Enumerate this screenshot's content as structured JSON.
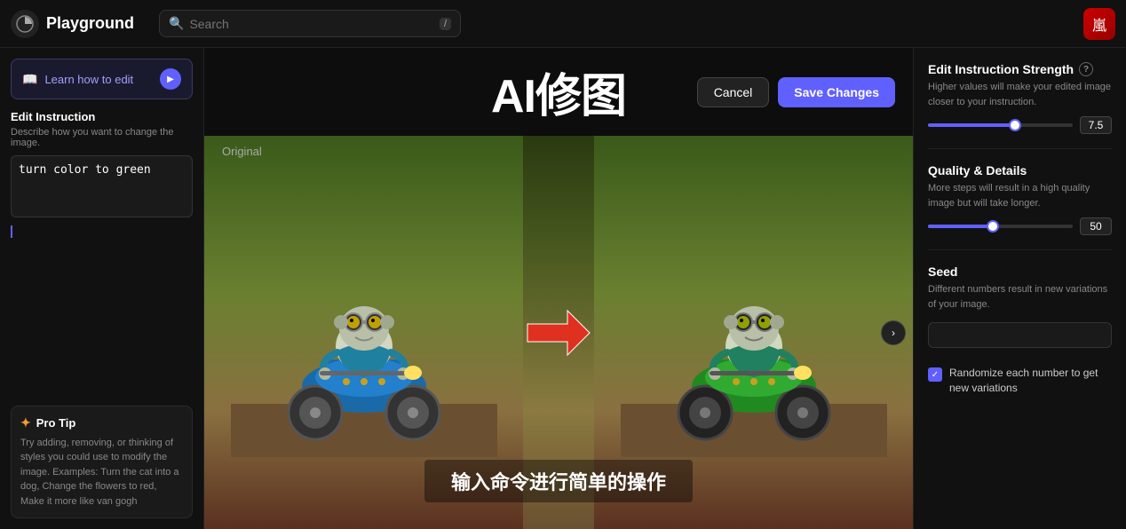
{
  "topbar": {
    "logo_icon": "◑",
    "logo_text": "Playground",
    "search_placeholder": "Search",
    "kbd": "/",
    "avatar_emoji": "嵐"
  },
  "left_sidebar": {
    "learn_btn_text": "Learn how to edit",
    "play_icon": "▶",
    "edit_instruction": {
      "title": "Edit Instruction",
      "description": "Describe how you want to change the image.",
      "value": "turn color to green"
    },
    "pro_tip": {
      "title": "Pro Tip",
      "icon": "✦",
      "text": "Try adding, removing, or thinking of styles you could use to modify the image. Examples: Turn the cat into a dog, Change the flowers to red, Make it more like van gogh"
    }
  },
  "center": {
    "title": "AI修图",
    "cancel_label": "Cancel",
    "save_label": "Save Changes",
    "original_label": "Original",
    "subtitle": "输入命令进行简单的操作"
  },
  "right_sidebar": {
    "strength_title": "Edit Instruction Strength",
    "strength_desc": "Higher values will make your edited image closer to your instruction.",
    "strength_value": "7.5",
    "strength_pct": 60,
    "quality_title": "Quality & Details",
    "quality_desc": "More steps will result in a high quality image but will take longer.",
    "quality_value": "50",
    "quality_pct": 45,
    "seed_title": "Seed",
    "seed_desc": "Different numbers result in new variations of your image.",
    "seed_value": "",
    "seed_placeholder": "",
    "randomize_label": "Randomize each number to get new variations"
  }
}
